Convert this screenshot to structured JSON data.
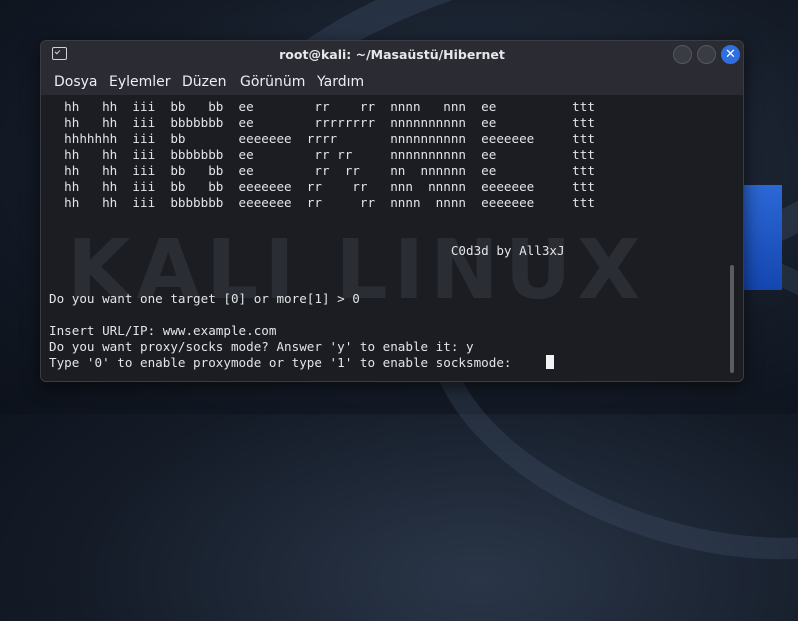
{
  "window": {
    "title": "root@kali: ~/Masaüstü/Hibernet"
  },
  "menu": [
    {
      "label": "Dosya"
    },
    {
      "label": "Eylemler"
    },
    {
      "label": "Düzen"
    },
    {
      "label": "Görünüm"
    },
    {
      "label": "Yardım"
    }
  ],
  "controls": {
    "close_glyph": "✕"
  },
  "icons": [
    "terminal-icon",
    "minimize-icon",
    "maximize-icon",
    "close-icon"
  ],
  "colors": {
    "accent": "#2f6fe0",
    "terminal_bg": "#1c1d22",
    "text": "#e3e4e8"
  },
  "terminal": {
    "lines": [
      "  hh   hh  iii  bb   bb  ee        rr    rr  nnnn   nnn  ee          ttt",
      "  hh   hh  iii  bbbbbbb  ee        rrrrrrrr  nnnnnnnnnn  ee          ttt",
      "  hhhhhhh  iii  bb       eeeeeee  rrrr       nnnnnnnnnn  eeeeeee     ttt",
      "  hh   hh  iii  bbbbbbb  ee        rr rr     nnnnnnnnnn  ee          ttt",
      "  hh   hh  iii  bb   bb  ee        rr  rr    nn  nnnnnn  ee          ttt",
      "  hh   hh  iii  bb   bb  eeeeeee  rr    rr   nnn  nnnnn  eeeeeee     ttt",
      "  hh   hh  iii  bbbbbbb  eeeeeee  rr     rr  nnnn  nnnn  eeeeeee     ttt",
      "",
      "",
      "                                                     C0d3d by All3xJ",
      "",
      "",
      "Do you want one target [0] or more[1] > 0",
      "",
      "Insert URL/IP: www.example.com",
      "Do you want proxy/socks mode? Answer 'y' to enable it: y",
      "Type '0' to enable proxymode or type '1' to enable socksmode: "
    ]
  }
}
